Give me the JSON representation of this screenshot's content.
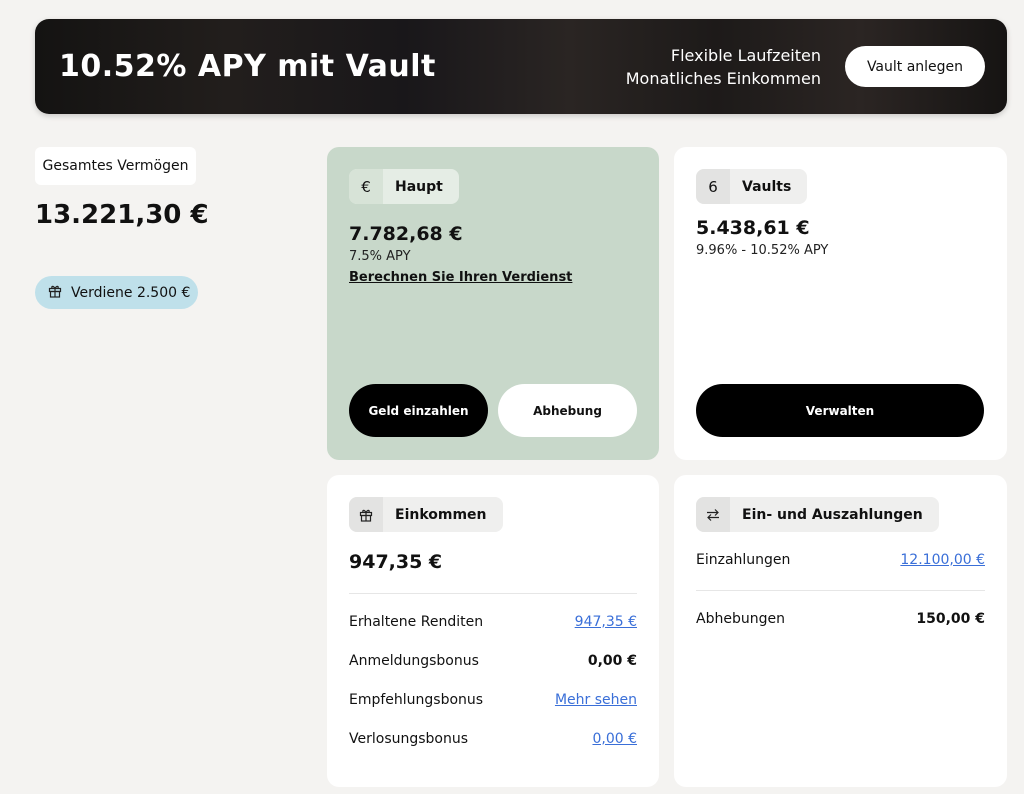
{
  "banner": {
    "title": "10.52% APY mit Vault",
    "line1": "Flexible Laufzeiten",
    "line2": "Monatliches Einkommen",
    "button_label": "Vault anlegen"
  },
  "summary": {
    "total_label": "Gesamtes Vermögen",
    "total_value": "13.221,30 €",
    "earn_label": "Verdiene 2.500 €",
    "earn_icon": "gift-icon"
  },
  "main_account": {
    "icon_symbol": "€",
    "label": "Haupt",
    "amount": "7.782,68 €",
    "apy": "7.5% APY",
    "calc_link": "Berechnen Sie Ihren Verdienst",
    "deposit_button": "Geld einzahlen",
    "withdraw_button": "Abhebung",
    "color": "#c8d8ca"
  },
  "vaults": {
    "count": "6",
    "label": "Vaults",
    "amount": "5.438,61 €",
    "apy_range": "9.96% - 10.52% APY",
    "manage_button": "Verwalten"
  },
  "income": {
    "label": "Einkommen",
    "icon": "gift-icon",
    "amount": "947,35 €",
    "rows": [
      {
        "label": "Erhaltene Renditen",
        "value": "947,35 €",
        "link": true
      },
      {
        "label": "Anmeldungsbonus",
        "value": "0,00 €",
        "link": false
      },
      {
        "label": "Empfehlungsbonus",
        "value": "Mehr sehen",
        "link": true
      },
      {
        "label": "Verlosungsbonus",
        "value": "0,00 €",
        "link": true
      }
    ]
  },
  "transfers": {
    "label": "Ein- und Auszahlungen",
    "icon": "transfer-arrows-icon",
    "rows": [
      {
        "label": "Einzahlungen",
        "value": "12.100,00 €",
        "link": true
      },
      {
        "label": "Abhebungen",
        "value": "150,00 €",
        "link": false
      }
    ]
  },
  "colors": {
    "accent_link": "#3a6fd8",
    "earn_pill": "#bfe0ea",
    "background": "#f4f3f1"
  }
}
